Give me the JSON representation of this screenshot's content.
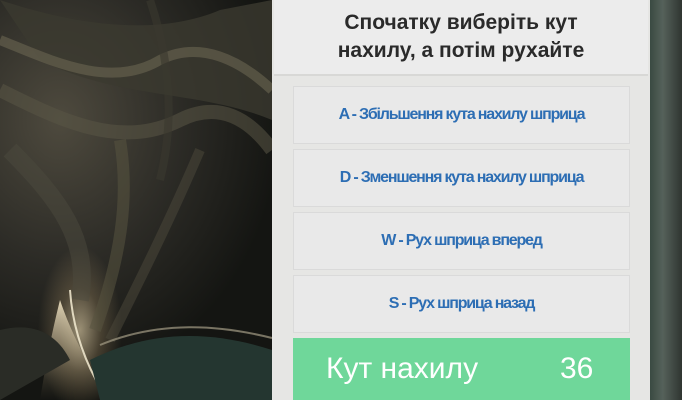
{
  "header": {
    "instruction": "Спочатку виберіть кут\nнахилу, а потім рухайте"
  },
  "controls": [
    {
      "key": "A",
      "label": "A - Збільшення кута нахилу шприца"
    },
    {
      "key": "D",
      "label": "D - Зменшення кута нахилу шприца"
    },
    {
      "key": "W",
      "label": "W - Рух шприца вперед"
    },
    {
      "key": "S",
      "label": "S - Рух шприца назад"
    }
  ],
  "angle": {
    "label": "Кут нахилу",
    "value": "36"
  },
  "colors": {
    "button_text": "#2d6eb4",
    "angle_bar": "#6fd79a",
    "panel": "#e6e6e4"
  }
}
